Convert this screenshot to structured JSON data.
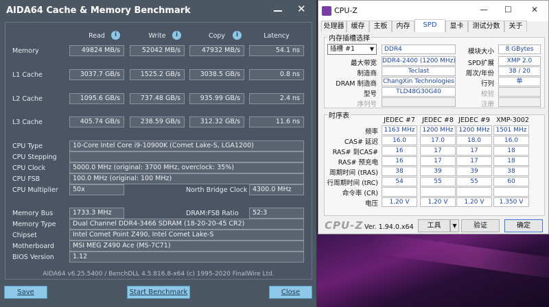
{
  "aida": {
    "title": "AIDA64 Cache & Memory Benchmark",
    "columns": {
      "read": "Read",
      "write": "Write",
      "copy": "Copy",
      "latency": "Latency"
    },
    "bench_rows": [
      {
        "label": "Memory",
        "read": "49824 MB/s",
        "write": "52042 MB/s",
        "copy": "47932 MB/s",
        "latency": "54.1 ns"
      },
      {
        "label": "L1 Cache",
        "read": "3037.7 GB/s",
        "write": "1525.2 GB/s",
        "copy": "3038.5 GB/s",
        "latency": "0.8 ns"
      },
      {
        "label": "L2 Cache",
        "read": "1095.6 GB/s",
        "write": "737.48 GB/s",
        "copy": "935.99 GB/s",
        "latency": "2.4 ns"
      },
      {
        "label": "L3 Cache",
        "read": "405.74 GB/s",
        "write": "238.59 GB/s",
        "copy": "312.32 GB/s",
        "latency": "11.6 ns"
      }
    ],
    "cpu_type_label": "CPU Type",
    "cpu_type": "10-Core Intel Core i9-10900K  (Comet Lake-S, LGA1200)",
    "cpu_stepping_label": "CPU Stepping",
    "cpu_stepping": "",
    "cpu_clock_label": "CPU Clock",
    "cpu_clock": "5000.0 MHz  (original: 3700 MHz, overclock: 35%)",
    "cpu_fsb_label": "CPU FSB",
    "cpu_fsb": "100.0 MHz  (original: 100 MHz)",
    "cpu_mult_label": "CPU Multiplier",
    "cpu_mult": "50x",
    "nb_clock_label": "North Bridge Clock",
    "nb_clock": "4300.0 MHz",
    "mem_bus_label": "Memory Bus",
    "mem_bus": "1733.3 MHz",
    "dram_fsb_label": "DRAM:FSB Ratio",
    "dram_fsb": "52:3",
    "mem_type_label": "Memory Type",
    "mem_type": "Dual Channel DDR4-3466 SDRAM  (18-20-20-45 CR2)",
    "chipset_label": "Chipset",
    "chipset": "Intel Comet Point Z490, Intel Comet Lake-S",
    "motherboard_label": "Motherboard",
    "motherboard": "MSI MEG Z490 Ace (MS-7C71)",
    "bios_label": "BIOS Version",
    "bios": "1.12",
    "footer": "AIDA64 v6.25.5400 / BenchDLL 4.5.816.8-x64  (c) 1995-2020 FinalWire Ltd.",
    "buttons": {
      "save": "Save",
      "start": "Start Benchmark",
      "close": "Close"
    }
  },
  "cpuz": {
    "title": "CPU-Z",
    "window_buttons": {
      "minimize": "—",
      "maximize": "☐",
      "close": "✕"
    },
    "tabs": [
      "处理器",
      "缓存",
      "主板",
      "内存",
      "SPD",
      "显卡",
      "测试分数",
      "关于"
    ],
    "active_tab": "SPD",
    "slot_group_title": "内存插槽选择",
    "slot_select": "插槽 #1",
    "module_type": "DDR4",
    "max_bandwidth_label": "最大带宽",
    "max_bandwidth": "DDR4-2400 (1200 MHz)",
    "manufacturer_label": "制造商",
    "manufacturer": "Teclast",
    "dram_mfr_label": "DRAM 制造商",
    "dram_mfr": "ChangXin Technologies",
    "part_label": "型号",
    "part": "TLD48G30G40",
    "serial_label": "序列号",
    "serial": "",
    "module_size_label": "模块大小",
    "module_size": "8 GBytes",
    "spd_ext_label": "SPD扩展",
    "spd_ext": "XMP 2.0",
    "week_year_label": "周次/年份",
    "week_year": "38 / 20",
    "ranks_label": "行列",
    "ranks": "单",
    "correction_label": "校验",
    "correction": "",
    "registered_label": "注册",
    "registered": "",
    "timing_group_title": "时序表",
    "timing_headers": [
      "JEDEC #7",
      "JEDEC #8",
      "JEDEC #9",
      "XMP-3002"
    ],
    "timing_rows": [
      {
        "label": "频率",
        "values": [
          "1163 MHz",
          "1200 MHz",
          "1200 MHz",
          "1501 MHz"
        ]
      },
      {
        "label": "CAS# 延迟",
        "values": [
          "16.0",
          "17.0",
          "18.0",
          "16.0"
        ]
      },
      {
        "label": "RAS# 到CAS#",
        "values": [
          "16",
          "17",
          "17",
          "18"
        ]
      },
      {
        "label": "RAS# 预充电",
        "values": [
          "16",
          "17",
          "17",
          "18"
        ]
      },
      {
        "label": "周期时间 (tRAS)",
        "values": [
          "38",
          "39",
          "39",
          "38"
        ]
      },
      {
        "label": "行周期时间 (tRC)",
        "values": [
          "54",
          "55",
          "55",
          "60"
        ]
      },
      {
        "label": "命令率 (CR)",
        "values": [
          "",
          "",
          "",
          ""
        ]
      },
      {
        "label": "电压",
        "values": [
          "1.20 V",
          "1.20 V",
          "1.20 V",
          "1.350 V"
        ]
      }
    ],
    "logo": "CPU-Z",
    "version": "Ver. 1.94.0.x64",
    "tools_button": "工具",
    "validate_button": "验证",
    "ok_button": "确定"
  }
}
